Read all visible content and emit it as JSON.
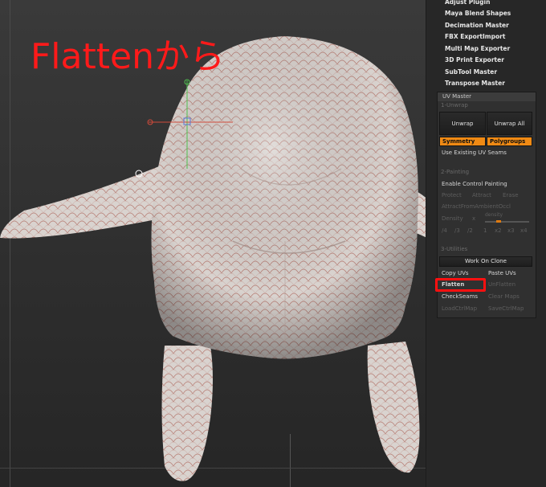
{
  "headline": "Flattenから",
  "plugin_menu": {
    "items": [
      "Adjust Plugin",
      "Maya Blend Shapes",
      "Decimation Master",
      "FBX ExportImport",
      "Multi Map Exporter",
      "3D Print Exporter",
      "SubTool Master",
      "Transpose Master"
    ]
  },
  "uv_master": {
    "title": "UV Master",
    "unwrap_section": "1-Unwrap",
    "unwrap": "Unwrap",
    "unwrap_all": "Unwrap All",
    "symmetry": "Symmetry",
    "polygroups": "Polygroups",
    "use_existing_seams": "Use Existing UV Seams",
    "painting_section": "2-Painting",
    "enable_control_painting": "Enable Control Painting",
    "protect": "Protect",
    "attract": "Attract",
    "erase": "Erase",
    "attract_from_ao": "AttractFromAmbientOccl",
    "density": "Density",
    "density_x": "x",
    "density_slider_label": "density",
    "ratios": [
      "/4",
      "/3",
      "/2",
      "1",
      "x2",
      "x3",
      "x4"
    ],
    "utilities_section": "3-Utilities",
    "work_on_clone": "Work On Clone",
    "copy_uvs": "Copy UVs",
    "paste_uvs": "Paste UVs",
    "flatten": "Flatten",
    "unflatten": "UnFlatten",
    "check_seams": "CheckSeams",
    "clear_maps": "Clear Maps",
    "load_ctrl_map": "LoadCtrlMap",
    "save_ctrl_map": "SaveCtrlMap"
  },
  "colors": {
    "highlight": "#ff1010",
    "accent_orange": "#f08a14",
    "headline_red": "#ff1a1a",
    "model_skin": "#d9d4d0"
  }
}
